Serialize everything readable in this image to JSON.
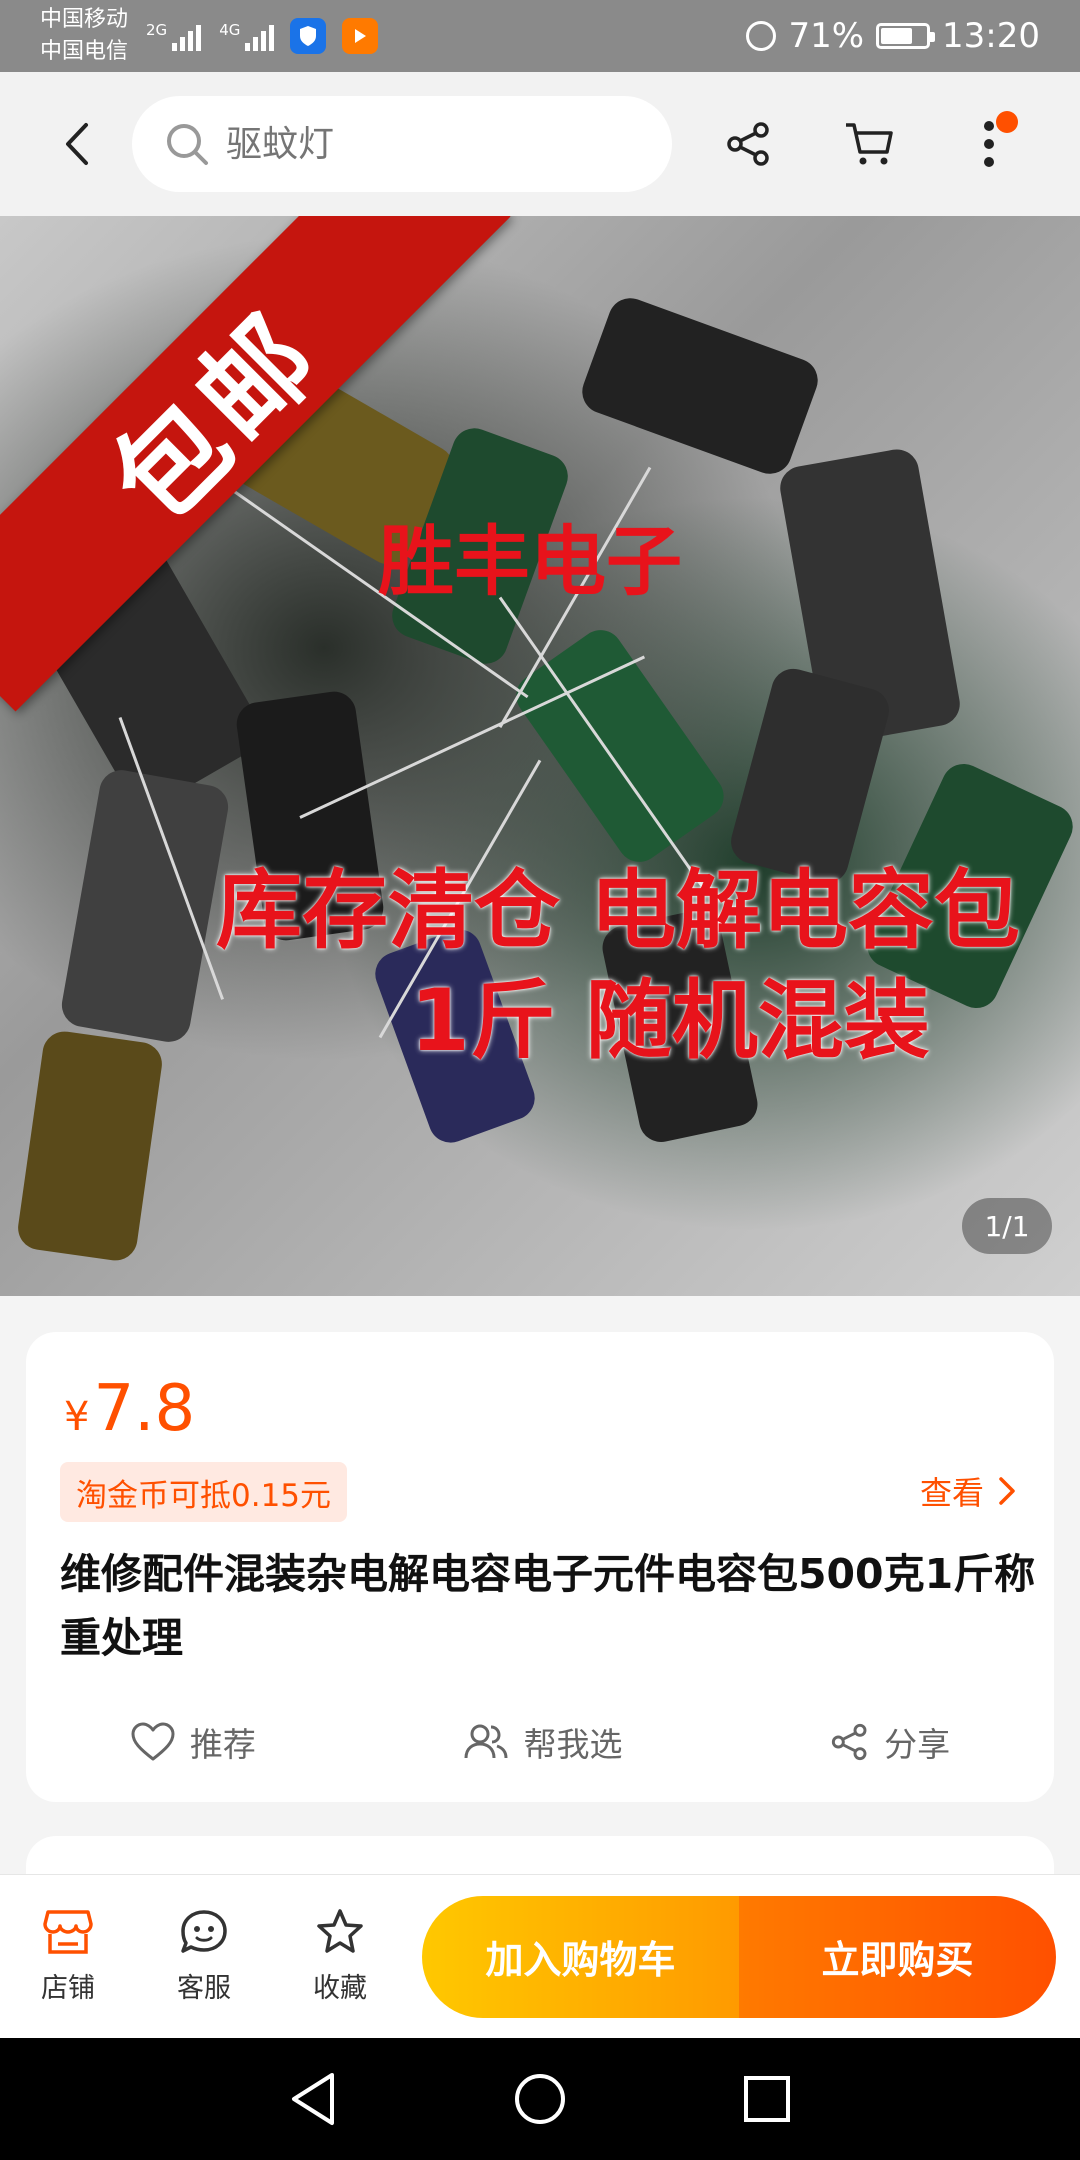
{
  "status_bar": {
    "carrier_1": "中国移动",
    "carrier_2": "中国电信",
    "signal_1_label": "2G",
    "signal_2_label": "4G",
    "battery_percent": "71%",
    "battery_level": 0.71,
    "time": "13:20"
  },
  "top_nav": {
    "search_placeholder": "驱蚊灯",
    "cart_badge_color": "#ff5000"
  },
  "hero": {
    "ribbon_text": "包邮",
    "brand_text": "胜丰电子",
    "line_1": "库存清仓 电解电容包",
    "line_2": "1斤    随机混装",
    "pager": "1/1"
  },
  "product": {
    "currency": "¥",
    "price": "7.8",
    "coin_text": "淘金币可抵0.15元",
    "view_label": "查看",
    "title": "维修配件混装杂电解电容电子元件电容包500克1斤称重处理",
    "actions": [
      {
        "label": "推荐",
        "icon": "heart-icon"
      },
      {
        "label": "帮我选",
        "icon": "people-icon"
      },
      {
        "label": "分享",
        "icon": "share-icon"
      }
    ]
  },
  "bottom_bar": {
    "tabs": [
      {
        "label": "店铺",
        "icon": "store-icon"
      },
      {
        "label": "客服",
        "icon": "service-icon"
      },
      {
        "label": "收藏",
        "icon": "star-icon"
      }
    ],
    "add_to_cart": "加入购物车",
    "buy_now": "立即购买"
  },
  "colors": {
    "accent": "#ff5000",
    "cart_button": "#ffb400",
    "buy_button": "#ff5000"
  }
}
